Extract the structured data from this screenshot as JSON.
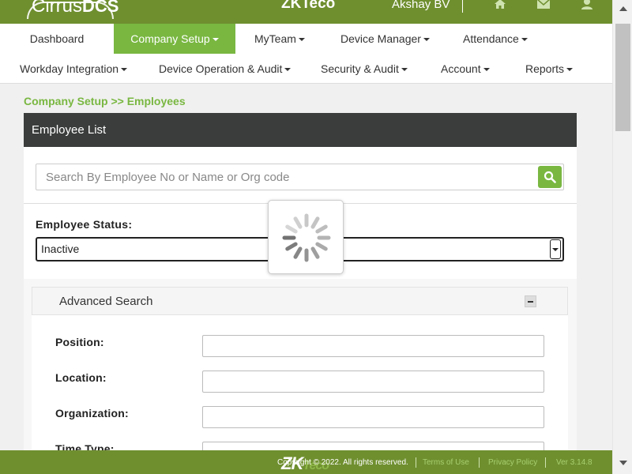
{
  "header": {
    "logo_part1": "Cirrus",
    "logo_part2": "DCS",
    "center_brand": "ZKTeco",
    "user_name": "Akshay BV",
    "icons": [
      "home-icon",
      "mail-icon",
      "user-icon"
    ]
  },
  "nav": {
    "row1": [
      {
        "label": "Dashboard",
        "dropdown": false
      },
      {
        "label": "Company Setup",
        "dropdown": true,
        "active": true
      },
      {
        "label": "MyTeam",
        "dropdown": true
      },
      {
        "label": "Device Manager",
        "dropdown": true
      },
      {
        "label": "Attendance",
        "dropdown": true
      }
    ],
    "row2": [
      {
        "label": "Workday Integration",
        "dropdown": true
      },
      {
        "label": "Device Operation & Audit",
        "dropdown": true
      },
      {
        "label": "Security & Audit",
        "dropdown": true
      },
      {
        "label": "Account",
        "dropdown": true
      },
      {
        "label": "Reports",
        "dropdown": true
      }
    ]
  },
  "breadcrumb": "Company Setup >> Employees",
  "panel": {
    "title": "Employee List",
    "search_placeholder": "Search By Employee No or Name or Org code",
    "status_label": "Employee Status:",
    "status_value": "Inactive",
    "advanced_title": "Advanced Search",
    "fields": [
      {
        "label": "Position:",
        "value": ""
      },
      {
        "label": "Location:",
        "value": ""
      },
      {
        "label": "Organization:",
        "value": ""
      },
      {
        "label": "Time Type:",
        "value": ""
      }
    ]
  },
  "footer": {
    "copyright": "Copyright © 2022. All rights reserved.",
    "logo_main": "ZK",
    "logo_sub": "Teco",
    "terms": "Terms of Use",
    "privacy": "Privacy Policy",
    "version": "Ver 3.14.8"
  },
  "colors": {
    "brand_green": "#6f8f2f",
    "accent_green": "#79b741",
    "panel_header": "#3a3d3c"
  }
}
